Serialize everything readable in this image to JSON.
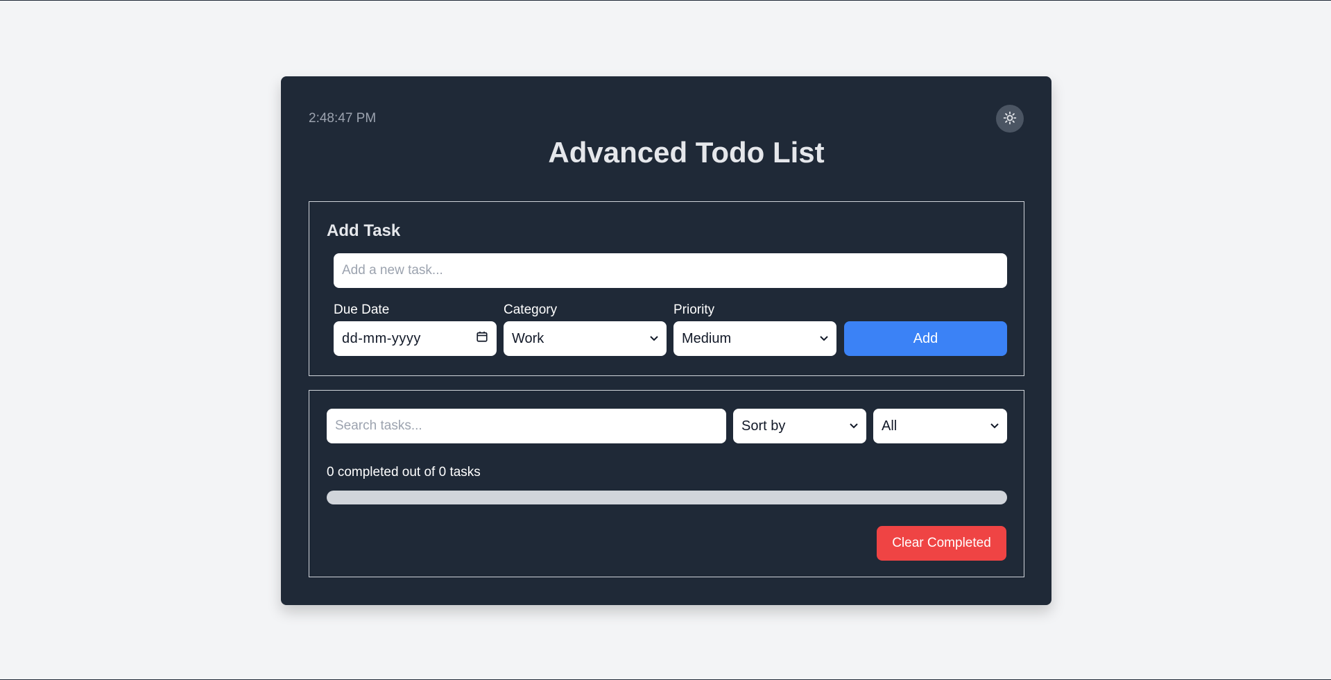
{
  "header": {
    "clock": "2:48:47 PM",
    "title": "Advanced Todo List",
    "theme_icon": "sun-icon"
  },
  "add_task": {
    "heading": "Add Task",
    "task_placeholder": "Add a new task...",
    "task_value": "",
    "due_date_label": "Due Date",
    "due_date_placeholder": "dd-mm-yyyy",
    "category_label": "Category",
    "category_value": "Work",
    "priority_label": "Priority",
    "priority_value": "Medium",
    "add_label": "Add"
  },
  "list_controls": {
    "search_placeholder": "Search tasks...",
    "sort_value": "Sort by",
    "filter_value": "All",
    "progress_text": "0 completed out of 0 tasks",
    "progress_fraction": 0,
    "clear_label": "Clear Completed"
  },
  "colors": {
    "card_background": "#1f2937",
    "page_background": "#f3f4f6",
    "primary": "#3b82f6",
    "danger": "#ef4444"
  }
}
